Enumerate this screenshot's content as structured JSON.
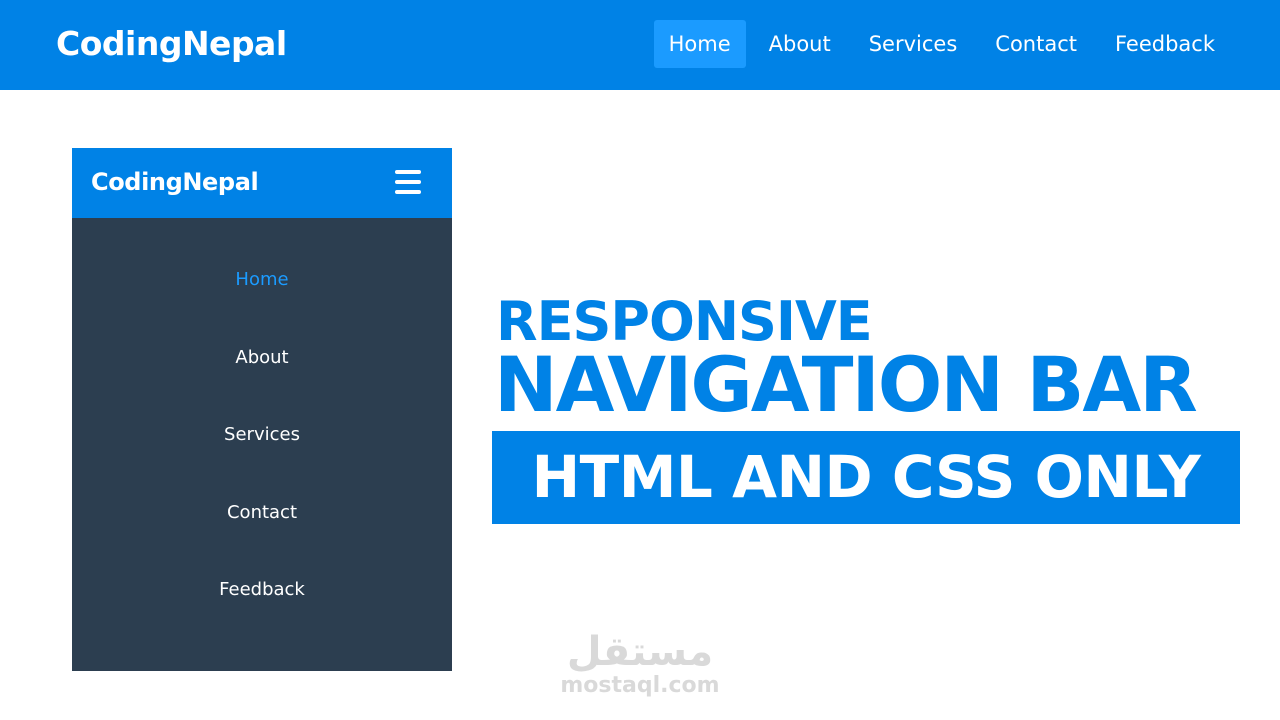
{
  "header": {
    "logo": "CodingNepal",
    "nav": [
      {
        "label": "Home",
        "active": true
      },
      {
        "label": "About",
        "active": false
      },
      {
        "label": "Services",
        "active": false
      },
      {
        "label": "Contact",
        "active": false
      },
      {
        "label": "Feedback",
        "active": false
      }
    ]
  },
  "mobile": {
    "logo": "CodingNepal",
    "menu_icon": "hamburger-icon",
    "menu": [
      {
        "label": "Home",
        "active": true
      },
      {
        "label": "About",
        "active": false
      },
      {
        "label": "Services",
        "active": false
      },
      {
        "label": "Contact",
        "active": false
      },
      {
        "label": "Feedback",
        "active": false
      }
    ]
  },
  "headline": {
    "line1": "RESPONSIVE",
    "line2": "NAVIGATION BAR",
    "banner": "HTML AND CSS ONLY"
  },
  "watermark": {
    "arabic": "مستقل",
    "latin": "mostaql.com"
  },
  "colors": {
    "primary": "#0082e6",
    "active_link_bg": "#1b9bff",
    "mobile_menu_bg": "#2c3e50"
  }
}
